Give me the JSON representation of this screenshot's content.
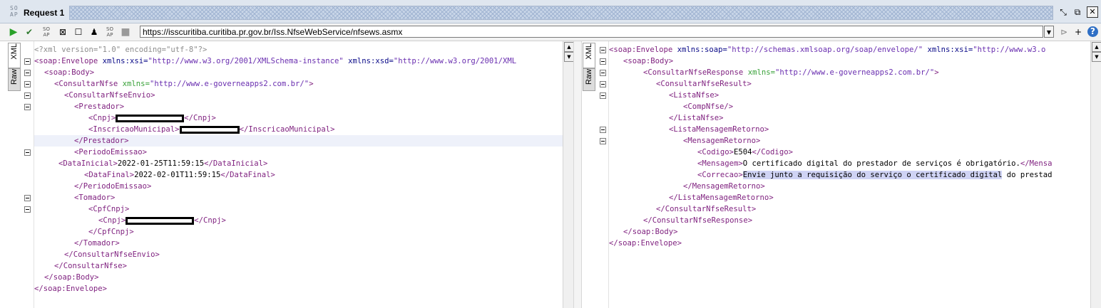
{
  "window": {
    "soap_logo": "SO\nAP",
    "title": "Request 1",
    "buttons": [
      "minimize-icon",
      "detach-icon",
      "close-icon"
    ]
  },
  "toolbar": {
    "url": "https://isscuritiba.curitiba.pr.gov.br/Iss.NfseWebService/nfsews.asmx"
  },
  "left_panel": {
    "tabs": [
      "XML",
      "Raw"
    ],
    "lines": {
      "l0": "<?xml version=\"1.0\" encoding=\"utf-8\"?>",
      "l1_open": "<soap:Envelope",
      "l1_a1": " xmlns:xsi=",
      "l1_v1": "\"http://www.w3.org/2001/XMLSchema-instance\"",
      "l1_a2": " xmlns:xsd=",
      "l1_v2": "\"http://www.w3.org/2001/XML",
      "l2": "<soap:Body>",
      "l3_open": "<ConsultarNfse",
      "l3_a": " xmlns=",
      "l3_v": "\"http://www.e-governeapps2.com.br/\"",
      "l3_close": ">",
      "l4": "<ConsultarNfseEnvio>",
      "l5": "<Prestador>",
      "l6_open": "<Cnpj>",
      "l6_close": "</Cnpj>",
      "l7_open": "<InscricaoMunicipal>",
      "l7_close": "</InscricaoMunicipal>",
      "l8": "</Prestador>",
      "l9": "<PeriodoEmissao>",
      "l10_open": "<DataInicial>",
      "l10_val": "2022-01-25T11:59:15",
      "l10_close": "</DataInicial>",
      "l11_open": "<DataFinal>",
      "l11_val": "2022-02-01T11:59:15",
      "l11_close": "</DataFinal>",
      "l12": "</PeriodoEmissao>",
      "l13": "<Tomador>",
      "l14": "<CpfCnpj>",
      "l15_open": "<Cnpj>",
      "l15_close": "</Cnpj>",
      "l16": "</CpfCnpj>",
      "l17": "</Tomador>",
      "l18": "</ConsultarNfseEnvio>",
      "l19": "</ConsultarNfse>",
      "l20": "</soap:Body>",
      "l21": "</soap:Envelope>"
    }
  },
  "right_panel": {
    "tabs": [
      "XML",
      "Raw"
    ],
    "lines": {
      "r0_open": "<soap:Envelope",
      "r0_a1": " xmlns:soap=",
      "r0_v1": "\"http://schemas.xmlsoap.org/soap/envelope/\"",
      "r0_a2": " xmlns:xsi=",
      "r0_v2": "\"http://www.w3.o",
      "r1": "<soap:Body>",
      "r2_open": "<ConsultarNfseResponse",
      "r2_a": " xmlns=",
      "r2_v": "\"http://www.e-governeapps2.com.br/\"",
      "r2_close": ">",
      "r3": "<ConsultarNfseResult>",
      "r4": "<ListaNfse>",
      "r5": "<CompNfse/>",
      "r6": "</ListaNfse>",
      "r7": "<ListaMensagemRetorno>",
      "r8": "<MensagemRetorno>",
      "r9_open": "<Codigo>",
      "r9_val": "E504",
      "r9_close": "</Codigo>",
      "r10_open": "<Mensagem>",
      "r10_val": "O certificado digital do prestador de serviços é obrigatório.",
      "r10_close": "</Mensa",
      "r11_open": "<Correcao>",
      "r11_hl": "Envie junto a requisição do serviço o certificado digital",
      "r11_rest": " do prestad",
      "r12": "</MensagemRetorno>",
      "r13": "</ListaMensagemRetorno>",
      "r14": "</ConsultarNfseResult>",
      "r15": "</ConsultarNfseResponse>",
      "r16": "</soap:Body>",
      "r17": "</soap:Envelope>"
    }
  }
}
